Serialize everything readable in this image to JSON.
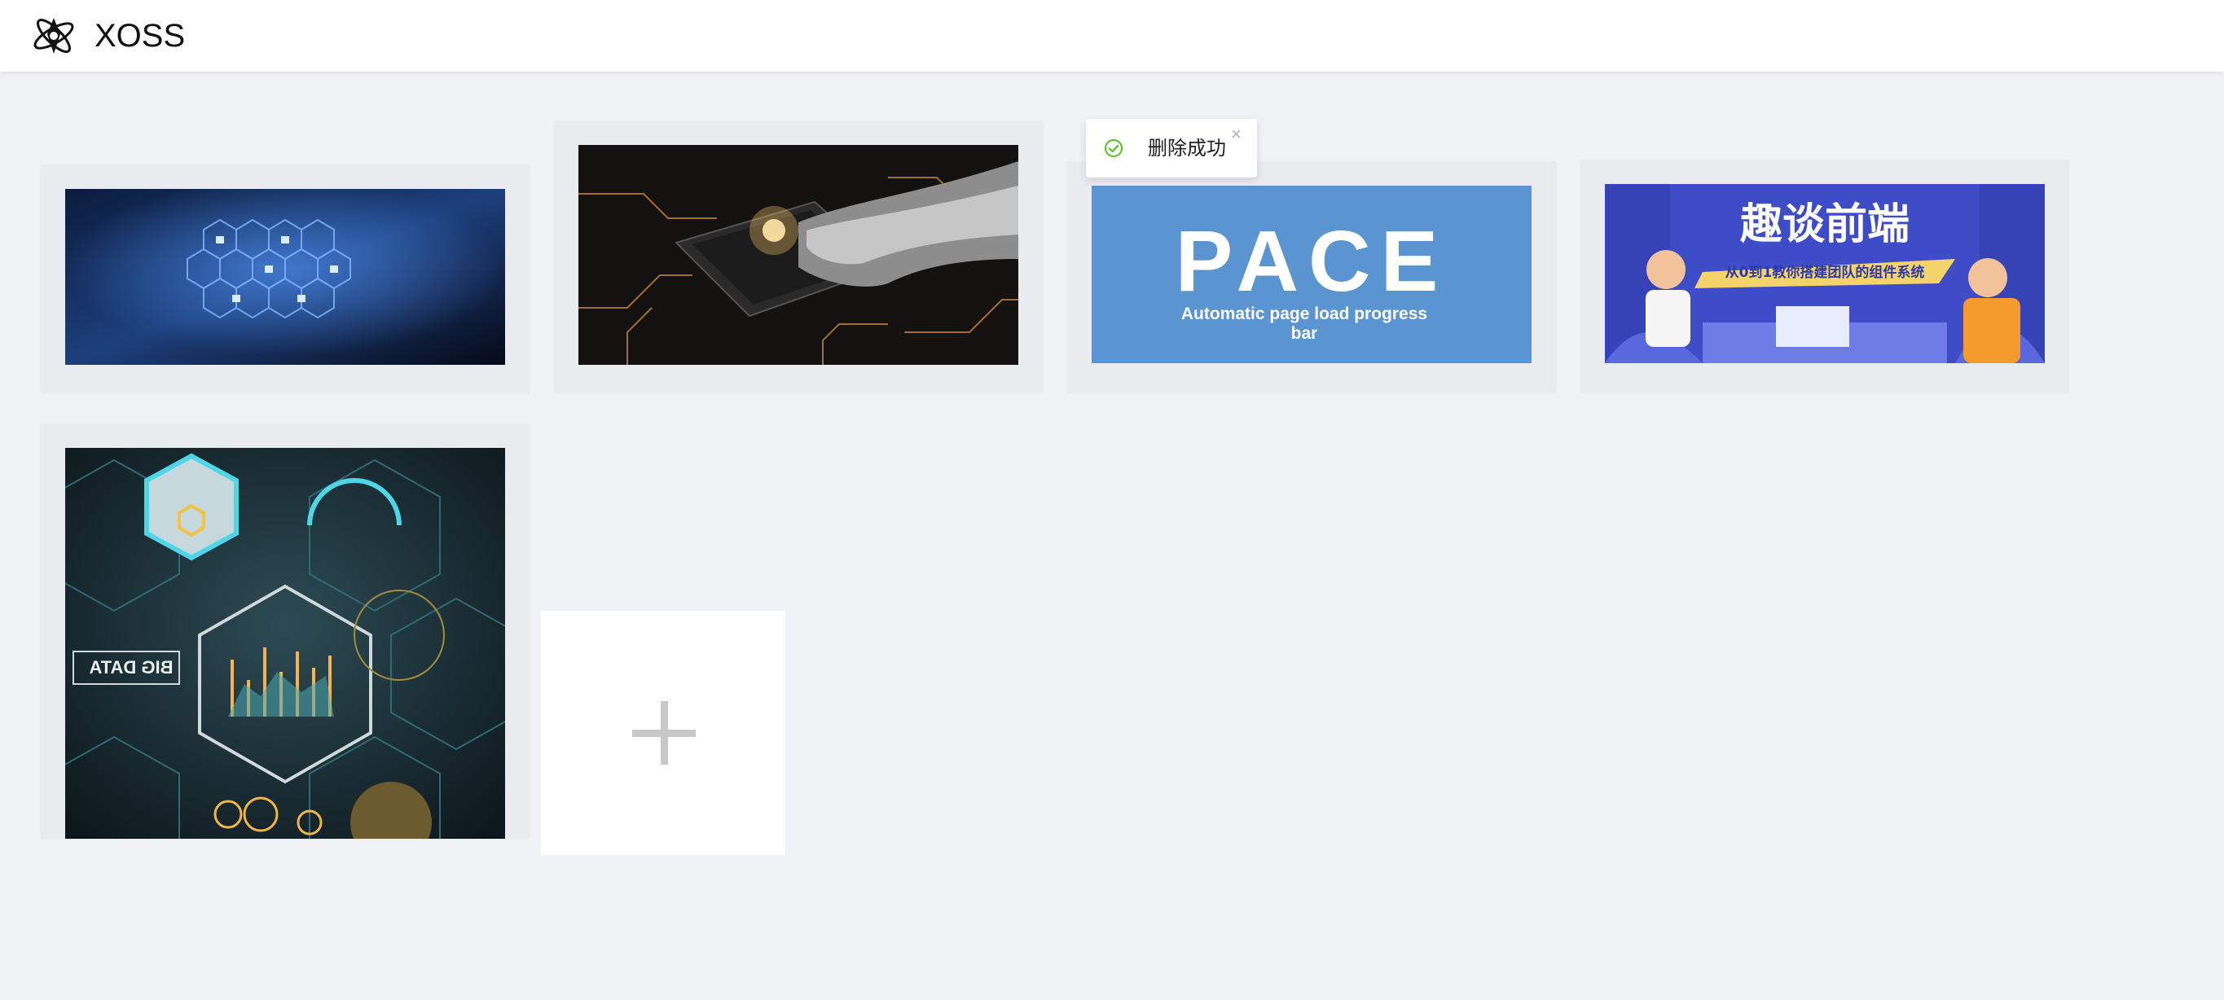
{
  "header": {
    "app_title": "XOSS",
    "logo_icon": "xoss-logo-icon"
  },
  "toast": {
    "message": "删除成功",
    "status_icon": "check-circle-icon",
    "close_label": "×",
    "accent": "#52c41a"
  },
  "gallery": {
    "cards": [
      {
        "name": "keyboard-security-hex",
        "description_icon": "image"
      },
      {
        "name": "robot-hand-chip",
        "description_icon": "image"
      },
      {
        "name": "pace",
        "title": "PACE",
        "subtitle_line1": "Automatic page load progress",
        "subtitle_line2": "bar"
      },
      {
        "name": "qutan-frontend",
        "title": "趣谈前端",
        "subtitle": "从0到1教你搭建团队的组件系统"
      },
      {
        "name": "big-data-dashboard",
        "label": "BIG DATA"
      }
    ],
    "add_icon": "plus-icon"
  },
  "colors": {
    "pace_bg": "#5b95d1",
    "qutan_bg": "#3f4cc7",
    "page_bg": "#f0f2f5"
  }
}
